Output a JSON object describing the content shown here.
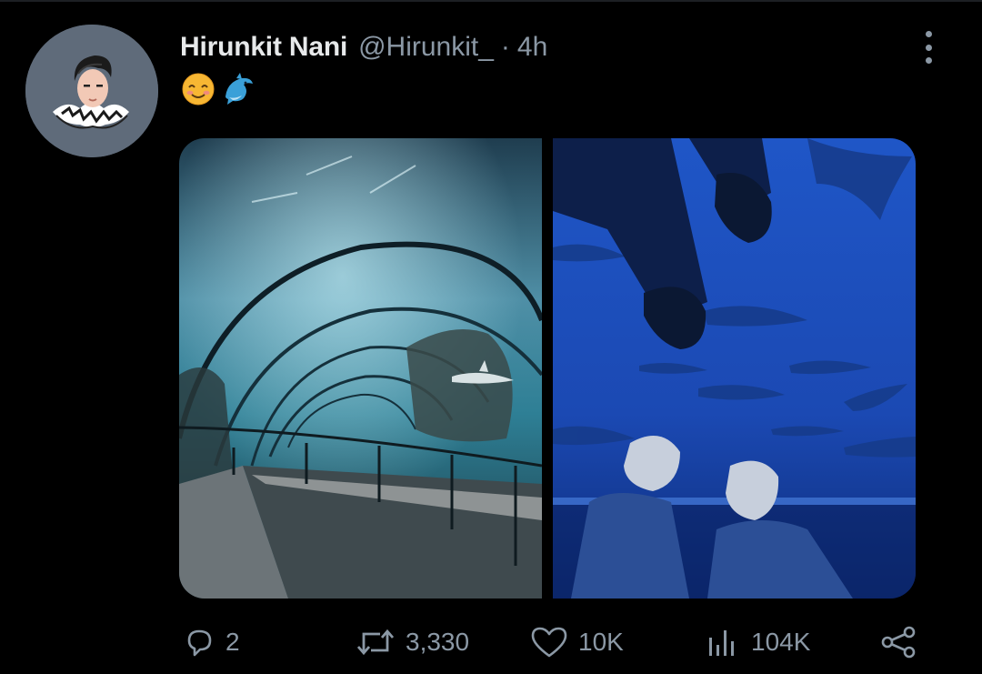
{
  "tweet": {
    "author_name": "Hirunkit Nani",
    "handle": "@Hirunkit_",
    "separator": "·",
    "time": "4h",
    "emojis": [
      "smiling-face-emoji",
      "dolphin-emoji"
    ]
  },
  "media": {
    "images": [
      {
        "name": "aquarium-tunnel-photo",
        "description_icon": "photo"
      },
      {
        "name": "aquarium-feet-photo",
        "description_icon": "photo"
      }
    ]
  },
  "actions": {
    "reply_count": "2",
    "retweet_count": "3,330",
    "like_count": "10K",
    "view_count": "104K"
  },
  "colors": {
    "background": "#000000",
    "primary_text": "#e7e9ea",
    "secondary_text": "#8b98a5",
    "avatar_bg": "#5f6b7a"
  }
}
